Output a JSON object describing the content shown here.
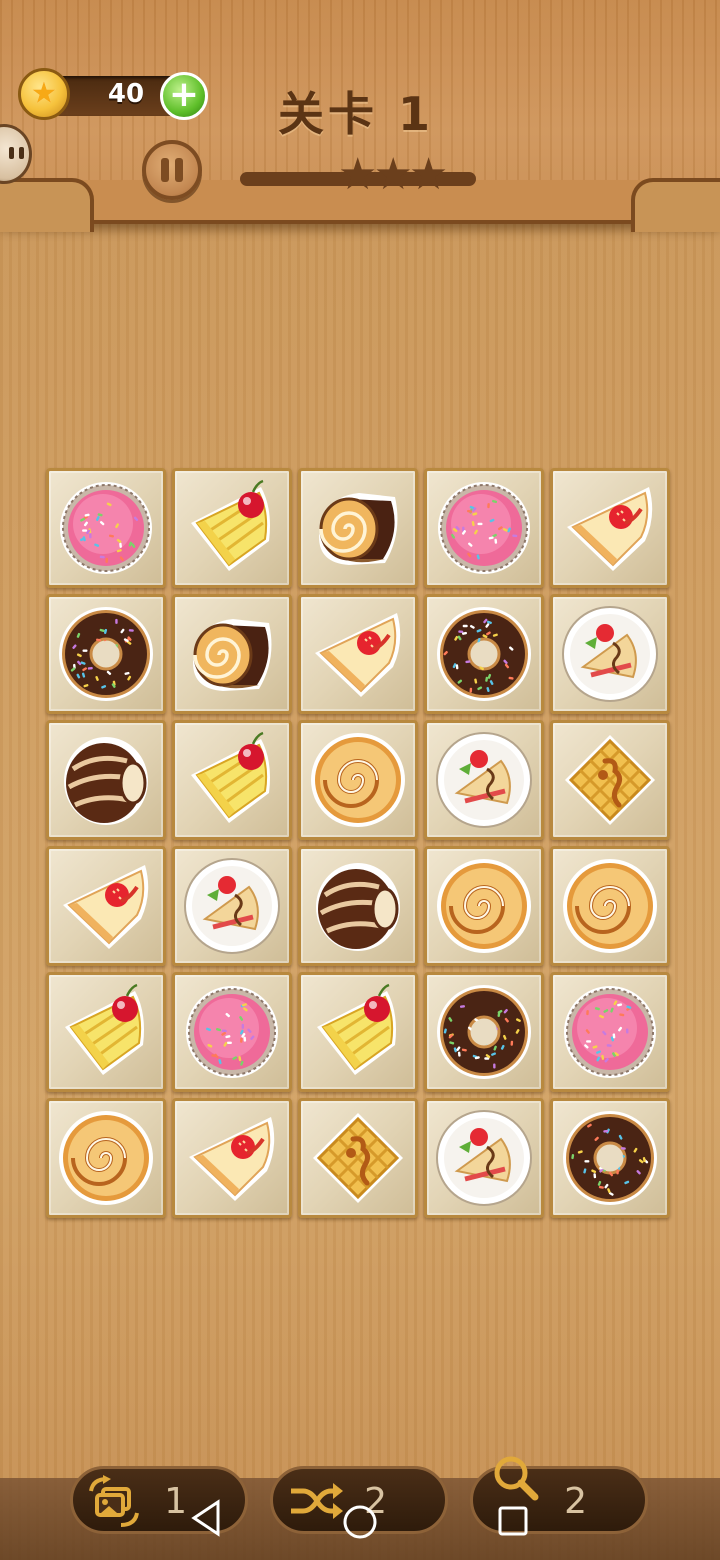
{
  "header": {
    "coins": "40",
    "level_title": "关卡 1"
  },
  "board": {
    "rows": [
      [
        "pink-cupcake",
        "pineapple-cake",
        "swiss-roll",
        "pink-cupcake",
        "strawberry-cake-slice"
      ],
      [
        "chocolate-donut",
        "swiss-roll",
        "strawberry-cake-slice",
        "chocolate-donut",
        "crepe-plate"
      ],
      [
        "chocolate-shell",
        "pineapple-cake",
        "cinnamon-roll",
        "crepe-plate",
        "waffle"
      ],
      [
        "strawberry-cake-slice",
        "crepe-plate",
        "chocolate-shell",
        "cinnamon-roll",
        "cinnamon-roll"
      ],
      [
        "pineapple-cake",
        "pink-cupcake",
        "pineapple-cake",
        "chocolate-donut",
        "pink-cupcake"
      ],
      [
        "cinnamon-roll",
        "strawberry-cake-slice",
        "waffle",
        "crepe-plate",
        "chocolate-donut"
      ]
    ]
  },
  "tools": {
    "undo_count": "1",
    "shuffle_count": "2",
    "hint_count": "2"
  },
  "colors": {
    "wood": "#cf9d60",
    "header_text": "#5b3414",
    "tile_face": "#e2d4b5",
    "tile_border": "#b8893f"
  }
}
